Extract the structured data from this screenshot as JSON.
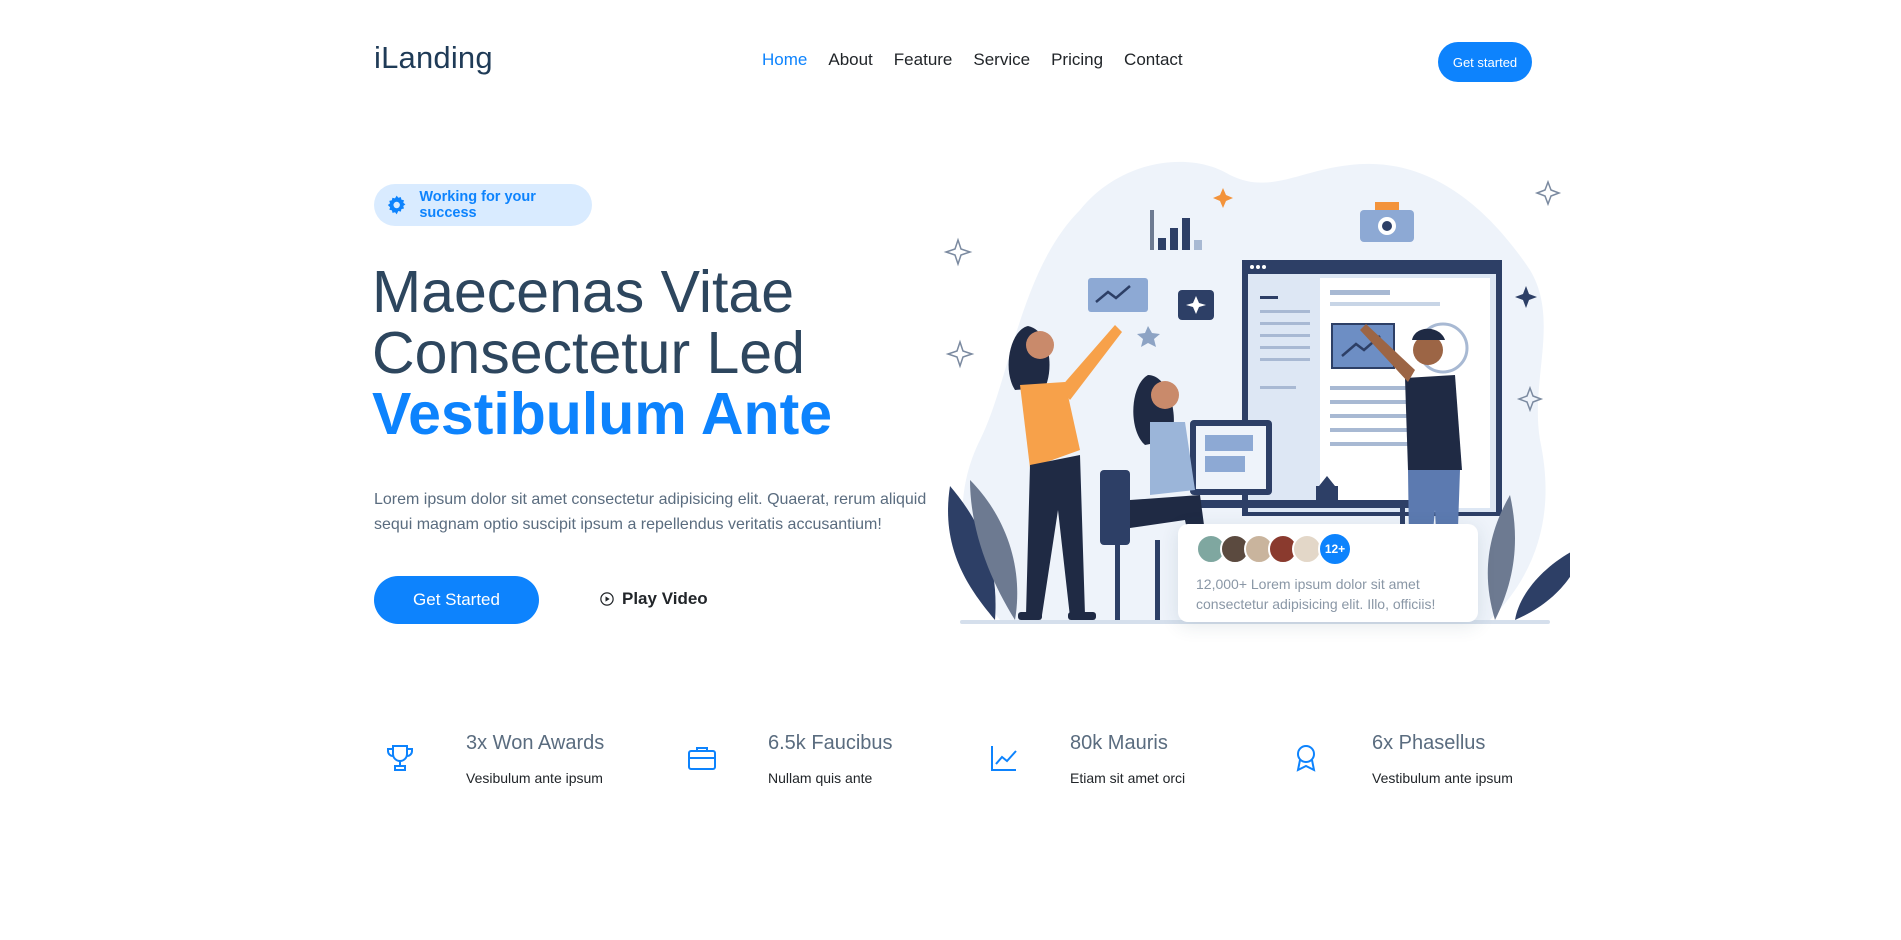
{
  "header": {
    "logo": "iLanding",
    "nav": [
      "Home",
      "About",
      "Feature",
      "Service",
      "Pricing",
      "Contact"
    ],
    "cta": "Get started"
  },
  "hero": {
    "badge": "Working for your success",
    "title_line1": "Maecenas Vitae",
    "title_line2": "Consectetur Led",
    "title_accent": "Vestibulum Ante",
    "lead": "Lorem ipsum dolor sit amet consectetur adipisicing elit. Quaerat, rerum aliquid sequi magnam optio suscipit ipsum a repellendus veritatis accusantium!",
    "primary_button": "Get Started",
    "video_button": "Play Video",
    "social": {
      "more_count": "12+",
      "text": "12,000+ Lorem ipsum dolor sit amet consectetur adipisicing elit. Illo, officiis!"
    }
  },
  "stats": [
    {
      "title": "3x Won Awards",
      "subtitle": "Vesibulum ante ipsum",
      "icon": "trophy-icon"
    },
    {
      "title": "6.5k Faucibus",
      "subtitle": "Nullam quis ante",
      "icon": "briefcase-icon"
    },
    {
      "title": "80k Mauris",
      "subtitle": "Etiam sit amet orci",
      "icon": "graph-up-icon"
    },
    {
      "title": "6x Phasellus",
      "subtitle": "Vestibulum ante ipsum",
      "icon": "award-icon"
    }
  ],
  "colors": {
    "accent": "#0d83fd",
    "heading": "#2d465e",
    "body_text": "#5a6c7f"
  }
}
